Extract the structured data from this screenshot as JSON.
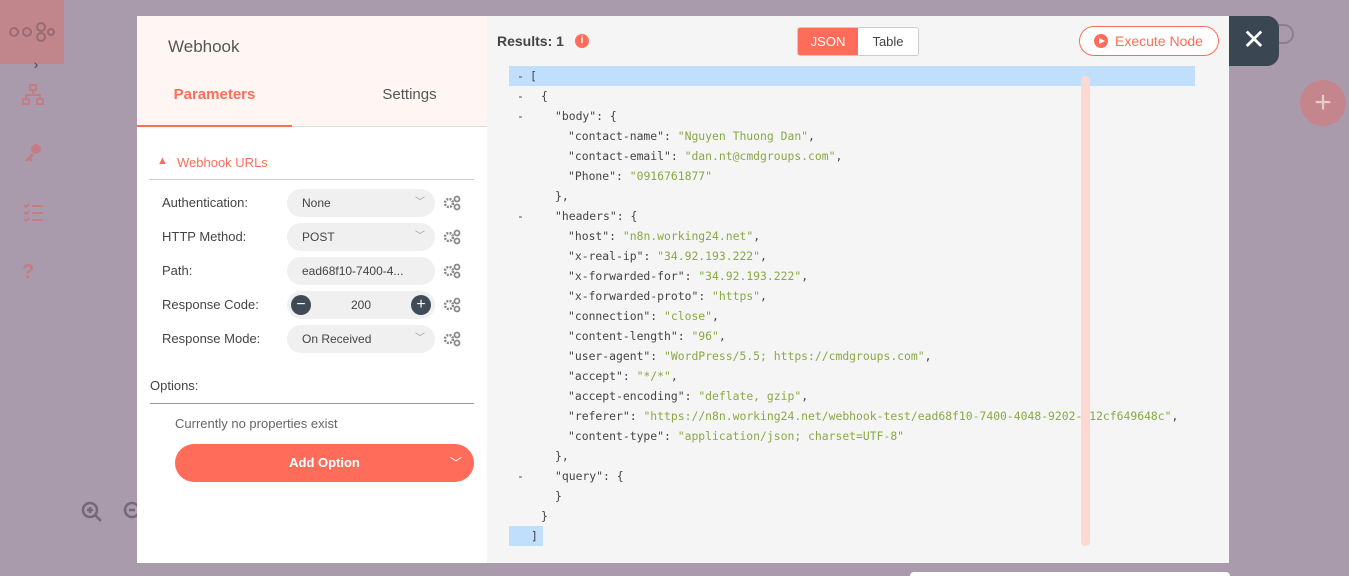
{
  "node": {
    "title": "Webhook",
    "tabs": [
      {
        "label": "Parameters"
      },
      {
        "label": "Settings"
      }
    ]
  },
  "section": {
    "label": "Webhook URLs"
  },
  "params": [
    {
      "label": "Authentication:",
      "value": "None"
    },
    {
      "label": "HTTP Method:",
      "value": "POST"
    },
    {
      "label": "Path:",
      "value": "ead68f10-7400-4..."
    },
    {
      "label": "Response Code:",
      "value": "200"
    },
    {
      "label": "Response Mode:",
      "value": "On Received"
    }
  ],
  "options": {
    "label": "Options:",
    "empty_text": "Currently no properties exist",
    "add_label": "Add Option"
  },
  "results": {
    "label": "Results: 1",
    "view_tabs": [
      {
        "label": "JSON"
      },
      {
        "label": "Table"
      }
    ],
    "execute_label": "Execute Node"
  },
  "json_lines": [
    {
      "toggle": "-",
      "indent": 0,
      "text": "[",
      "hl": true
    },
    {
      "toggle": "-",
      "indent": 1,
      "text": "{"
    },
    {
      "toggle": "-",
      "indent": 2,
      "key": "\"body\"",
      "rest": ": {"
    },
    {
      "indent": 3,
      "key": "\"contact-name\"",
      "str": "\"Nguyen Thuong Dan\"",
      "tail": ","
    },
    {
      "indent": 3,
      "key": "\"contact-email\"",
      "str": "\"dan.nt@cmdgroups.com\"",
      "tail": ","
    },
    {
      "indent": 3,
      "key": "\"Phone\"",
      "str": "\"0916761877\"",
      "tail": ""
    },
    {
      "indent": 2,
      "text": "},"
    },
    {
      "toggle": "-",
      "indent": 2,
      "key": "\"headers\"",
      "rest": ": {"
    },
    {
      "indent": 3,
      "key": "\"host\"",
      "str": "\"n8n.working24.net\"",
      "tail": ","
    },
    {
      "indent": 3,
      "key": "\"x-real-ip\"",
      "str": "\"34.92.193.222\"",
      "tail": ","
    },
    {
      "indent": 3,
      "key": "\"x-forwarded-for\"",
      "str": "\"34.92.193.222\"",
      "tail": ","
    },
    {
      "indent": 3,
      "key": "\"x-forwarded-proto\"",
      "str": "\"https\"",
      "tail": ","
    },
    {
      "indent": 3,
      "key": "\"connection\"",
      "str": "\"close\"",
      "tail": ","
    },
    {
      "indent": 3,
      "key": "\"content-length\"",
      "str": "\"96\"",
      "tail": ","
    },
    {
      "indent": 3,
      "key": "\"user-agent\"",
      "str": "\"WordPress/5.5; https://cmdgroups.com\"",
      "tail": ","
    },
    {
      "indent": 3,
      "key": "\"accept\"",
      "str": "\"*/*\"",
      "tail": ","
    },
    {
      "indent": 3,
      "key": "\"accept-encoding\"",
      "str": "\"deflate, gzip\"",
      "tail": ","
    },
    {
      "indent": 3,
      "key": "\"referer\"",
      "str": "\"https://n8n.working24.net/webhook-test/ead68f10-7400-4048-9202-d12cf649648c\"",
      "tail": ","
    },
    {
      "indent": 3,
      "key": "\"content-type\"",
      "str": "\"application/json; charset=UTF-8\"",
      "tail": ""
    },
    {
      "indent": 2,
      "text": "},"
    },
    {
      "toggle": "-",
      "indent": 2,
      "key": "\"query\"",
      "rest": ": {"
    },
    {
      "indent": 2,
      "text": "}"
    },
    {
      "indent": 1,
      "text": "}"
    },
    {
      "indent": 0,
      "text": "]",
      "hl": true
    }
  ],
  "colors": {
    "accent": "#ff6d5a",
    "string": "#88a943",
    "highlight": "#bfdffc",
    "close": "#3a4753"
  }
}
